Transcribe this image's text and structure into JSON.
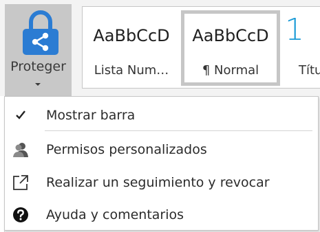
{
  "ribbon": {
    "protect_button": {
      "label": "Proteger",
      "icon": "lock-share-icon",
      "accent": "#2b7cd3"
    },
    "styles": [
      {
        "sample": "AaBbCcD",
        "name": "Lista Num…"
      },
      {
        "sample": "AaBbCcD",
        "name": "¶ Normal",
        "selected": true
      },
      {
        "sample": "1",
        "name": "Títu"
      }
    ]
  },
  "menu": {
    "items": [
      {
        "label": "Mostrar barra",
        "icon": "checkmark-icon",
        "checked": true
      },
      {
        "label": "Permisos personalizados",
        "icon": "person-permissions-icon"
      },
      {
        "label": "Realizar un seguimiento y revocar",
        "icon": "external-link-icon"
      },
      {
        "label": "Ayuda y comentarios",
        "icon": "help-icon"
      }
    ]
  }
}
